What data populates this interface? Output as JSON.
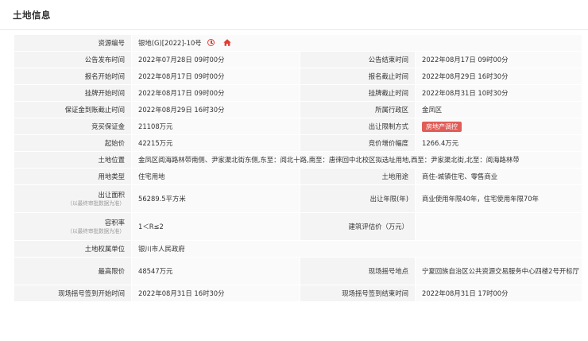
{
  "page": {
    "title": "土地信息"
  },
  "colors": {
    "accent_red": "#e03c31",
    "badge_bg": "#e05d58",
    "label_bg": "#f4f4f4",
    "value_bg": "#fafafa"
  },
  "rows": {
    "resource_no": {
      "label": "资源编号",
      "value": "银地(G)[2022]-10号",
      "icons": [
        "clock-icon",
        "home-icon"
      ]
    },
    "notice_start": {
      "label": "公告发布时间",
      "value": "2022年07月28日 09时00分"
    },
    "notice_end": {
      "label": "公告结束时间",
      "value": "2022年08月17日 09时00分"
    },
    "signup_start": {
      "label": "报名开始时间",
      "value": "2022年08月17日 09时00分"
    },
    "signup_end": {
      "label": "报名截止时间",
      "value": "2022年08月29日 16时30分"
    },
    "listing_start": {
      "label": "挂牌开始时间",
      "value": "2022年08月17日 09时00分"
    },
    "listing_end": {
      "label": "挂牌截止时间",
      "value": "2022年08月31日 10时30分"
    },
    "deposit_deadline": {
      "label": "保证金到账截止时间",
      "value": "2022年08月29日 16时30分"
    },
    "district": {
      "label": "所属行政区",
      "value": "金凤区"
    },
    "deposit": {
      "label": "竞买保证金",
      "value": "21108万元"
    },
    "transfer_restriction": {
      "label": "出让限制方式",
      "value": "房地产调控"
    },
    "start_price": {
      "label": "起始价",
      "value": "42215万元"
    },
    "bid_increment": {
      "label": "竞价增价幅度",
      "value": "1266.4万元"
    },
    "location": {
      "label": "土地位置",
      "value": "金凤区阅海路林带南侧、尹家渠北街东侧,东至：阅北十路,南至：唐徕回中北校区拟选址用地,西至：尹家渠北街,北至：阅海路林带"
    },
    "land_type": {
      "label": "用地类型",
      "value": "住宅用地"
    },
    "land_use": {
      "label": "土地用途",
      "value": "商住-城镇住宅、零售商业"
    },
    "area": {
      "label": "出让面积",
      "sublabel": "（以最终审批数据为准）",
      "value": "56289.5平方米"
    },
    "term": {
      "label": "出让年限(年)",
      "value": "商业使用年限40年，住宅使用年限70年"
    },
    "plot_ratio": {
      "label": "容积率",
      "sublabel": "（以最终审批数据为准）",
      "value": "1＜R≤2"
    },
    "building_price": {
      "label": "建筑评估价（万元）",
      "value": ""
    },
    "owner": {
      "label": "土地权属单位",
      "value": "银川市人民政府"
    },
    "max_price": {
      "label": "最高限价",
      "value": "48547万元"
    },
    "lottery_place": {
      "label": "现场摇号地点",
      "value": "宁夏回族自治区公共资源交易服务中心四楼2号开标厅"
    },
    "lottery_signin_start": {
      "label": "现场摇号签到开始时间",
      "value": "2022年08月31日 16时30分"
    },
    "lottery_signin_end": {
      "label": "现场摇号签到结束时间",
      "value": "2022年08月31日 17时00分"
    }
  }
}
